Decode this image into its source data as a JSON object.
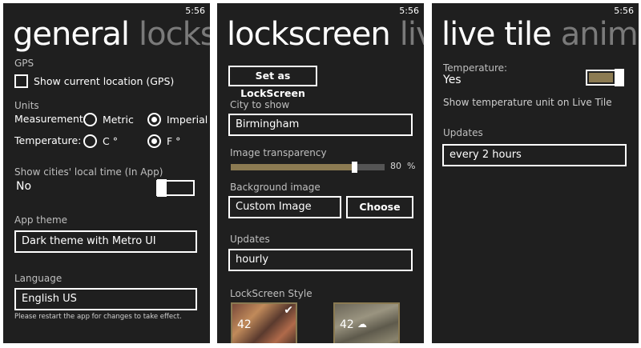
{
  "status": {
    "time": "5:56"
  },
  "general": {
    "pivot_active": "general",
    "pivot_next": "lockscreen",
    "gps_label": "GPS",
    "gps_checkbox_label": "Show current location (GPS)",
    "gps_checked": false,
    "units_label": "Units",
    "measurement_label": "Measurement:",
    "measurement_options": [
      "Metric",
      "Imperial"
    ],
    "measurement_selected": "Imperial",
    "temperature_label": "Temperature:",
    "temperature_options": [
      "C °",
      "F °"
    ],
    "temperature_selected": "F °",
    "local_time_label": "Show cities' local time (In App)",
    "local_time_value": "No",
    "local_time_on": false,
    "app_theme_label": "App theme",
    "app_theme_value": "Dark theme with Metro UI",
    "language_label": "Language",
    "language_value": "English US",
    "restart_note": "Please restart the app for changes to take effect."
  },
  "lockscreen": {
    "pivot_active": "lockscreen",
    "pivot_next": "live tile",
    "set_button": "Set as LockScreen",
    "city_label": "City to show",
    "city_value": "Birmingham",
    "transparency_label": "Image transparency",
    "transparency_value": 80,
    "transparency_text": "80",
    "transparency_unit": "%",
    "background_label": "Background image",
    "background_value": "Custom Image",
    "choose_button": "Choose",
    "updates_label": "Updates",
    "updates_value": "hourly",
    "style_label": "LockScreen Style",
    "style_thumb1_temp": "42",
    "style_thumb2_temp": "42"
  },
  "livetile": {
    "pivot_active": "live tile",
    "pivot_next": "animation",
    "temperature_label": "Temperature:",
    "temperature_value": "Yes",
    "temperature_on": true,
    "unit_note": "Show temperature unit on Live Tile",
    "updates_label": "Updates",
    "updates_value": "every 2 hours"
  },
  "colors": {
    "accent": "#8c7b52",
    "panel_bg": "#1f1f1f",
    "inactive_header": "#7a7a7a"
  }
}
